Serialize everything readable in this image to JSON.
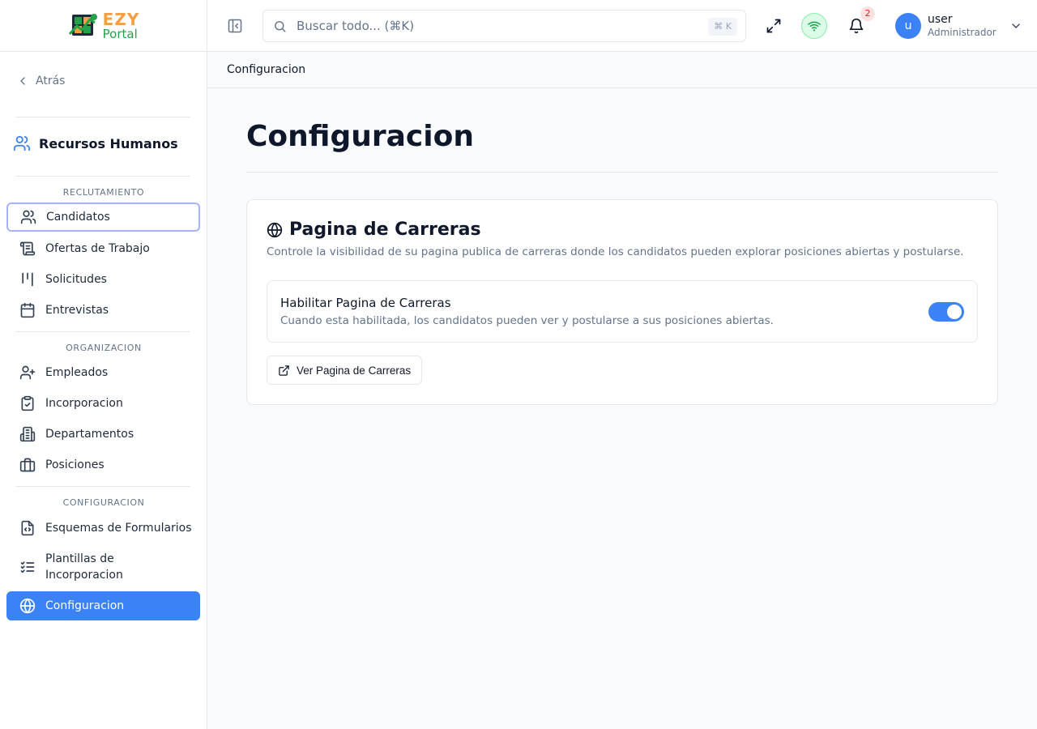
{
  "brand": {
    "line1": "EZY",
    "line2": "Portal"
  },
  "sidebar": {
    "back_label": "Atrás",
    "module_title": "Recursos Humanos",
    "sections": [
      {
        "label": "RECLUTAMIENTO",
        "items": [
          {
            "label": "Candidatos",
            "icon": "users-icon"
          },
          {
            "label": "Ofertas de Trabajo",
            "icon": "scroll-icon"
          },
          {
            "label": "Solicitudes",
            "icon": "kanban-icon"
          },
          {
            "label": "Entrevistas",
            "icon": "calendar-icon"
          }
        ]
      },
      {
        "label": "ORGANIZACION",
        "items": [
          {
            "label": "Empleados",
            "icon": "user-plus-icon"
          },
          {
            "label": "Incorporacion",
            "icon": "clipboard-check-icon"
          },
          {
            "label": "Departamentos",
            "icon": "building-icon"
          },
          {
            "label": "Posiciones",
            "icon": "briefcase-icon"
          }
        ]
      },
      {
        "label": "CONFIGURACION",
        "items": [
          {
            "label": "Esquemas de Formularios",
            "icon": "file-code-icon"
          },
          {
            "label": "Plantillas de Incorporacion",
            "icon": "list-checks-icon"
          },
          {
            "label": "Configuracion",
            "icon": "globe-icon",
            "active": true
          }
        ]
      }
    ]
  },
  "header": {
    "search_placeholder": "Buscar todo... (⌘K)",
    "search_shortcut": "⌘ K",
    "notification_count": "2",
    "user_initial": "u",
    "user_name": "user",
    "user_role": "Administrador"
  },
  "breadcrumb": "Configuracion",
  "main": {
    "title": "Configuracion",
    "card": {
      "title": "Pagina de Carreras",
      "description": "Controle la visibilidad de su pagina publica de carreras donde los candidatos pueden explorar posiciones abiertas y postularse.",
      "setting": {
        "title": "Habilitar Pagina de Carreras",
        "description": "Cuando esta habilitada, los candidatos pueden ver y postularse a sus posiciones abiertas.",
        "enabled": true
      },
      "button_label": "Ver Pagina de Carreras"
    }
  },
  "colors": {
    "accent": "#3b82f6",
    "brand_orange": "#f59e42",
    "brand_green": "#22a34a"
  }
}
